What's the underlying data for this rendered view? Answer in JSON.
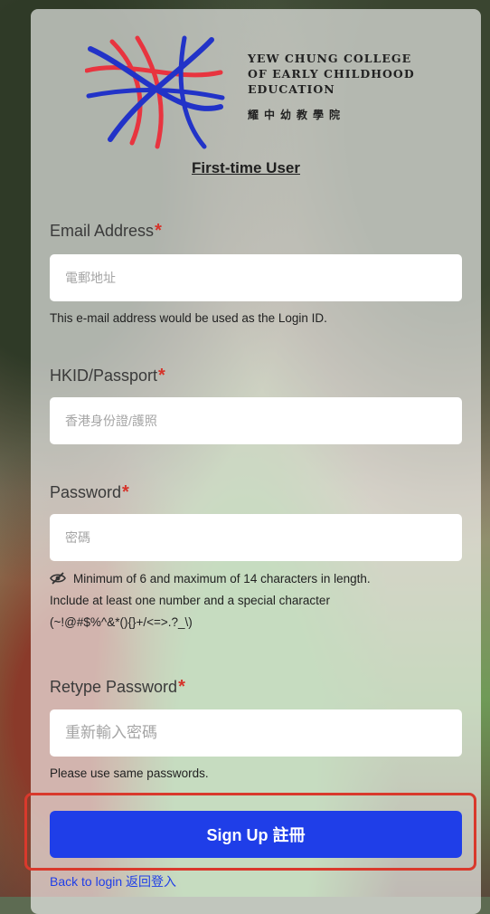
{
  "college": {
    "line1": "YEW CHUNG COLLEGE",
    "line2": "OF EARLY CHILDHOOD",
    "line3": "EDUCATION",
    "chinese_name": "耀中幼教學院"
  },
  "heading": "First-time User",
  "email": {
    "label": "Email Address",
    "required_mark": "*",
    "placeholder": "電郵地址",
    "hint": "This e-mail address would be used as the Login ID."
  },
  "hkid": {
    "label": "HKID/Passport",
    "required_mark": "*",
    "placeholder": "香港身份證/護照"
  },
  "password": {
    "label": "Password",
    "required_mark": "*",
    "placeholder": "密碼",
    "hint_line1": "Minimum of 6 and maximum of 14 characters in length.",
    "hint_line2": "Include at least one number and a special character",
    "hint_line3": "(~!@#$%^&*(){}+/<=>.?_\\)"
  },
  "retype": {
    "label": "Retype Password",
    "required_mark": "*",
    "placeholder": "重新輸入密碼",
    "hint": "Please use same passwords."
  },
  "signup_label": "Sign Up 註冊",
  "back_label": "Back to login 返回登入",
  "colors": {
    "accent": "#1f3ee8",
    "required": "#d6332a",
    "highlight": "#d9392c",
    "logo_red": "#e8343f",
    "logo_blue": "#2233c8"
  },
  "icons": [
    "logo-mark",
    "eye-slash-icon"
  ]
}
